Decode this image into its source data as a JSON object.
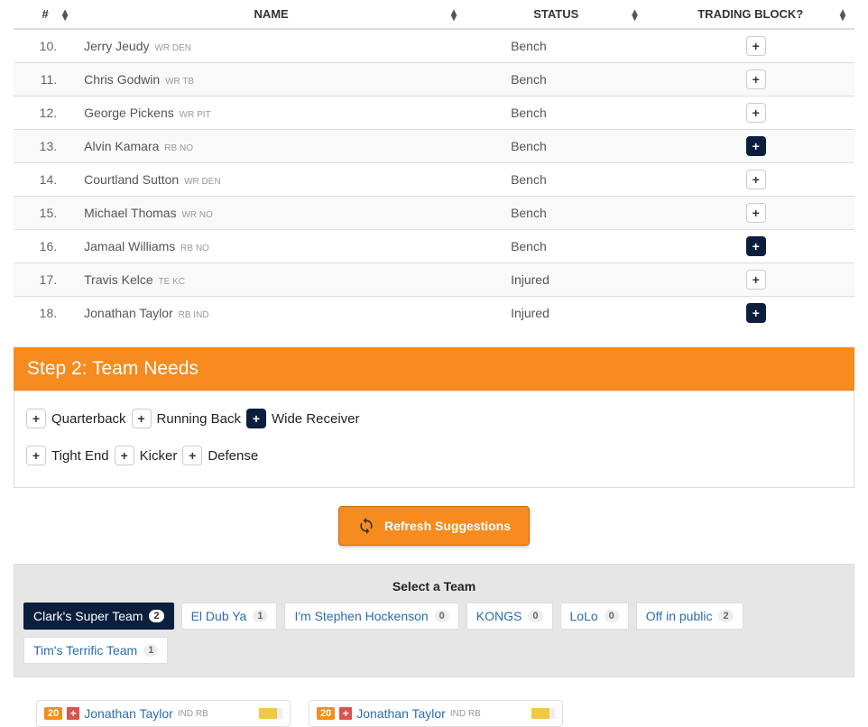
{
  "table": {
    "headers": {
      "num": "#",
      "name": "NAME",
      "status": "STATUS",
      "trade": "TRADING BLOCK?"
    },
    "rows": [
      {
        "num": "10.",
        "name": "Jerry Jeudy",
        "pos": "WR",
        "team": "DEN",
        "status": "Bench",
        "active": false
      },
      {
        "num": "11.",
        "name": "Chris Godwin",
        "pos": "WR",
        "team": "TB",
        "status": "Bench",
        "active": false
      },
      {
        "num": "12.",
        "name": "George Pickens",
        "pos": "WR",
        "team": "PIT",
        "status": "Bench",
        "active": false
      },
      {
        "num": "13.",
        "name": "Alvin Kamara",
        "pos": "RB",
        "team": "NO",
        "status": "Bench",
        "active": true
      },
      {
        "num": "14.",
        "name": "Courtland Sutton",
        "pos": "WR",
        "team": "DEN",
        "status": "Bench",
        "active": false
      },
      {
        "num": "15.",
        "name": "Michael Thomas",
        "pos": "WR",
        "team": "NO",
        "status": "Bench",
        "active": false
      },
      {
        "num": "16.",
        "name": "Jamaal Williams",
        "pos": "RB",
        "team": "NO",
        "status": "Bench",
        "active": true
      },
      {
        "num": "17.",
        "name": "Travis Kelce",
        "pos": "TE",
        "team": "KC",
        "status": "Injured",
        "active": false
      },
      {
        "num": "18.",
        "name": "Jonathan Taylor",
        "pos": "RB",
        "team": "IND",
        "status": "Injured",
        "active": true
      }
    ]
  },
  "step2": {
    "title": "Step 2: Team Needs",
    "needs": [
      {
        "label": "Quarterback",
        "active": false
      },
      {
        "label": "Running Back",
        "active": false
      },
      {
        "label": "Wide Receiver",
        "active": true
      },
      {
        "label": "Tight End",
        "active": false
      },
      {
        "label": "Kicker",
        "active": false
      },
      {
        "label": "Defense",
        "active": false
      }
    ]
  },
  "refresh_label": "Refresh Suggestions",
  "team_select": {
    "title": "Select a Team",
    "teams": [
      {
        "name": "Clark's Super Team",
        "count": "2",
        "selected": true
      },
      {
        "name": "El Dub Ya",
        "count": "1",
        "selected": false
      },
      {
        "name": "I'm Stephen Hockenson",
        "count": "0",
        "selected": false
      },
      {
        "name": "KONGS",
        "count": "0",
        "selected": false
      },
      {
        "name": "LoLo",
        "count": "0",
        "selected": false
      },
      {
        "name": "Off in public",
        "count": "2",
        "selected": false
      },
      {
        "name": "Tim's Terrific Team",
        "count": "1",
        "selected": false
      }
    ]
  },
  "cards": [
    {
      "rank": "20",
      "name": "Jonathan Taylor",
      "team": "IND",
      "pos": "RB",
      "bar_pct": 75
    },
    {
      "rank": "20",
      "name": "Jonathan Taylor",
      "team": "IND",
      "pos": "RB",
      "bar_pct": 75
    }
  ]
}
